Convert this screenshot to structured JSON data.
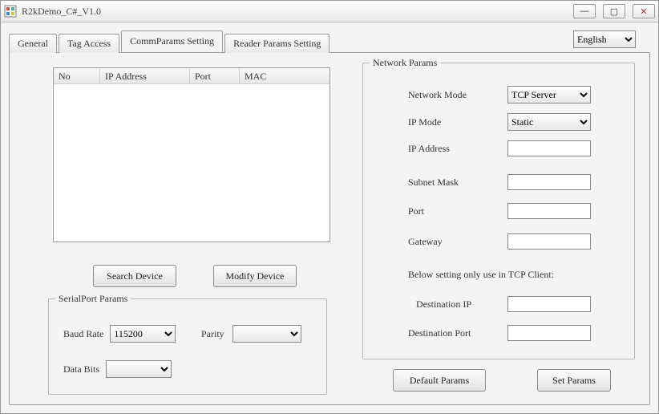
{
  "window": {
    "title": "R2kDemo_C#_V1.0"
  },
  "language": {
    "selected": "English"
  },
  "tabs": {
    "general": "General",
    "tag_access": "Tag Access",
    "comm_params": "CommParams Setting",
    "reader_params": "Reader Params Setting"
  },
  "device_table": {
    "headers": {
      "no": "No",
      "ip": "IP Address",
      "port": "Port",
      "mac": "MAC"
    }
  },
  "buttons": {
    "search_device": "Search Device",
    "modify_device": "Modify Device",
    "default_params": "Default Params",
    "set_params": "Set Params"
  },
  "serial": {
    "legend": "SerialPort Params",
    "baud_label": "Baud Rate",
    "baud_value": "115200",
    "parity_label": "Parity",
    "parity_value": "",
    "databits_label": "Data Bits",
    "databits_value": ""
  },
  "network": {
    "legend": "Network Params",
    "mode_label": "Network Mode",
    "mode_value": "TCP Server",
    "ipmode_label": "IP Mode",
    "ipmode_value": "Static",
    "ip_label": "IP Address",
    "ip_value": "",
    "mask_label": "Subnet Mask",
    "mask_value": "",
    "port_label": "Port",
    "port_value": "",
    "gw_label": "Gateway",
    "gw_value": "",
    "note": "Below setting only use in TCP Client:",
    "dip_label": "Destination IP",
    "dip_value": "",
    "dport_label": "Destination Port",
    "dport_value": ""
  }
}
